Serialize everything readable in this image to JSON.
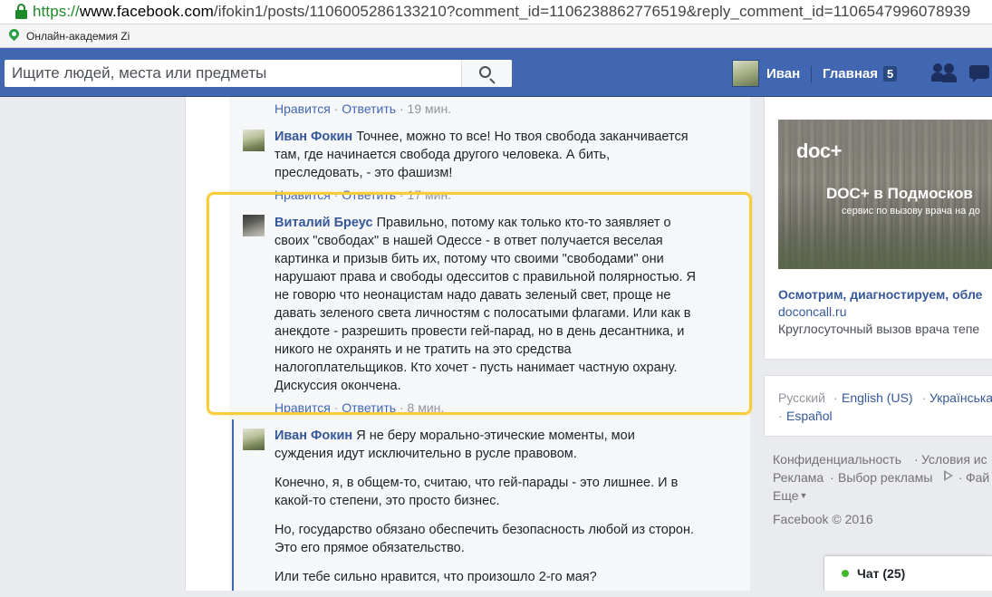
{
  "browser": {
    "url_scheme": "https://",
    "url_host": "www.facebook.com",
    "url_path": "/ifokin1/posts/1106005286133210?comment_id=1106238862776519&reply_comment_id=1106547996078939",
    "bookmark_label": "Онлайн-академия Zi"
  },
  "topbar": {
    "search_placeholder": "Ищите людей, места или предметы",
    "profile_name": "Иван",
    "home_label": "Главная",
    "home_badge": "5"
  },
  "comments": [
    {
      "actions": {
        "like": "Нравится",
        "reply": "Ответить",
        "time": "19 мин."
      }
    },
    {
      "author": "Иван Фокин",
      "lines": [
        "Точнее, можно то все! Но твоя свобода заканчивается",
        "там, где начинается свобода другого человека. А бить,",
        "преследовать, - это фашизм!"
      ],
      "actions": {
        "like": "Нравится",
        "reply": "Ответить",
        "time": "17 мин."
      }
    },
    {
      "author": "Виталий Бреус",
      "lines": [
        "Правильно, потому как только кто-то заявляет о",
        "своих \"свободах\" в нашей Одессе - в ответ получается веселая",
        "картинка и призыв бить их, потому что своими \"свободами\" они",
        "нарушают права и свободы одесситов с правильной полярностью. Я",
        "не говорю что неонацистам надо давать зеленый свет, проще не",
        "давать зеленого света личностям с полосатыми флагами. Или как в",
        "анекдоте - разрешить провести гей-парад, но в день десантника, и",
        "никого не охранять и не тратить на это средства",
        "налогоплательщиков. Кто хочет - пусть нанимает частную охрану.",
        "Дискуссия окончена."
      ],
      "actions": {
        "like": "Нравится",
        "reply": "Ответить",
        "time": "8 мин."
      }
    },
    {
      "author": "Иван Фокин",
      "paragraphs": [
        [
          "Я не беру морально-этические моменты, мои",
          "суждения идут исключительно в русле правовом."
        ],
        [
          "Конечно, я, в общем-то, считаю, что гей-парады - это лишнее. И в",
          "какой-то степени, это просто бизнес."
        ],
        [
          "Но, государство обязано обеспечить безопасность любой из сторон.",
          "Это его прямое обязательство."
        ],
        [
          "Или тебе сильно нравится, что произошло 2-го мая?"
        ]
      ]
    }
  ],
  "ad": {
    "logo": "doc+",
    "headline": "DOC+ в Подмосков",
    "subline": "сервис по вызову врача на до",
    "title": "Осмотрим, диагностируем, обле",
    "domain": "doconcall.ru",
    "description": "Круглосуточный вызов врача тепе"
  },
  "languages": {
    "current": "Русский",
    "english": "English (US)",
    "ukrainian": "Українська",
    "spanish": "Español",
    "separator": "·"
  },
  "footer": {
    "privacy": "Конфиденциальность",
    "terms": "Условия ис",
    "ads": "Реклама",
    "ad_choices": "Выбор рекламы",
    "files": "Фай",
    "more": "Еще",
    "copyright": "Facebook © 2016"
  },
  "chat": {
    "label": "Чат (25)"
  },
  "colors": {
    "fb_blue": "#4267b2",
    "link": "#365899",
    "highlight": "#f9cc3a",
    "online": "#42b72a"
  }
}
